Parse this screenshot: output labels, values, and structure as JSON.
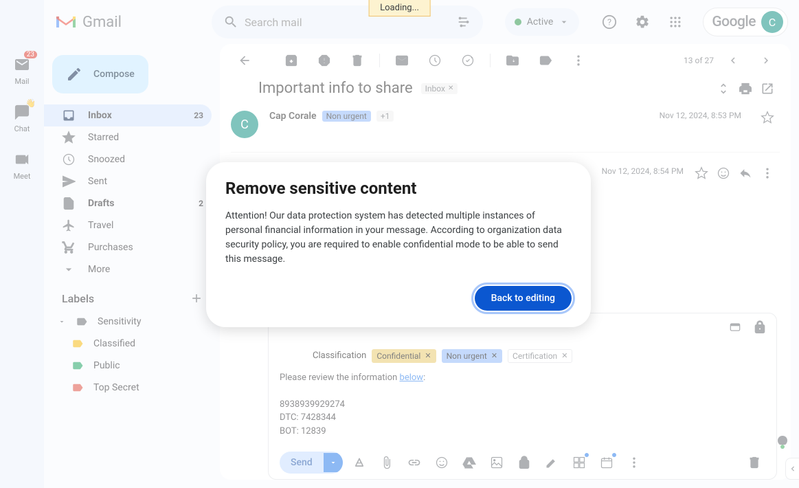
{
  "loading": "Loading...",
  "header": {
    "product": "Gmail",
    "search_placeholder": "Search mail",
    "status": "Active",
    "google": "Google",
    "avatar_initial": "C"
  },
  "rail": {
    "mail": "Mail",
    "mail_badge": "23",
    "chat": "Chat",
    "meet": "Meet"
  },
  "sidebar": {
    "compose": "Compose",
    "items": [
      {
        "label": "Inbox",
        "count": "23"
      },
      {
        "label": "Starred"
      },
      {
        "label": "Snoozed"
      },
      {
        "label": "Sent"
      },
      {
        "label": "Drafts",
        "count": "2"
      },
      {
        "label": "Travel"
      },
      {
        "label": "Purchases"
      },
      {
        "label": "More"
      }
    ],
    "labels_header": "Labels",
    "labels": [
      {
        "label": "Sensitivity",
        "color": "#5f6368"
      },
      {
        "label": "Classified",
        "color": "#f4b400"
      },
      {
        "label": "Public",
        "color": "#0f9d58"
      },
      {
        "label": "Top Secret",
        "color": "#db4437"
      }
    ]
  },
  "thread": {
    "pagination": "13 of 27",
    "subject": "Important info to share",
    "subject_tag": "Inbox",
    "messages": [
      {
        "sender": "Cap Corale",
        "avatar": "C",
        "avatar_color": "#00897b",
        "tag": "Non urgent",
        "tag_extra": "+1",
        "date": "Nov 12, 2024, 8:53 PM"
      },
      {
        "date": "Nov 12, 2024, 8:54 PM"
      }
    ]
  },
  "compose": {
    "classification_label": "Classification",
    "chips": [
      {
        "label": "Confidential",
        "bg": "#e6c665",
        "fg": "#3c4043"
      },
      {
        "label": "Non urgent",
        "bg": "#8ab4f8",
        "fg": "#1f1f1f"
      },
      {
        "label": "Certification",
        "bg": "#fff",
        "fg": "#5f6368",
        "border": "#dadce0"
      }
    ],
    "body_intro": "Please review the information ",
    "body_link": "below",
    "body_lines": [
      "8938939929274",
      "DTC: 7428344",
      "BOT: 12839"
    ],
    "send": "Send"
  },
  "modal": {
    "title": "Remove sensitive content",
    "body": "Attention! Our data protection system has detected multiple instances of personal financial information in your message. According to organization data security policy, you are required to enable confidential mode to be able to send this message.",
    "button": "Back to editing"
  }
}
